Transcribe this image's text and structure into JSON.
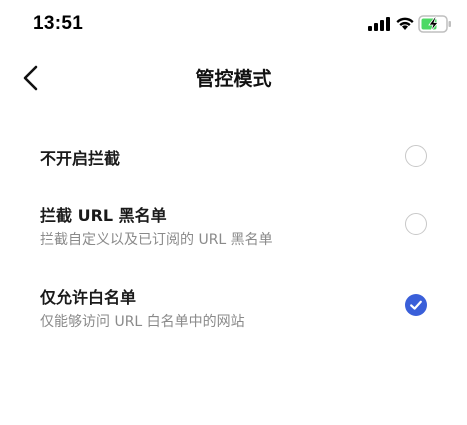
{
  "status_bar": {
    "time": "13:51"
  },
  "nav": {
    "title": "管控模式"
  },
  "options": [
    {
      "title": "不开启拦截",
      "subtitle": "",
      "selected": false
    },
    {
      "title": "拦截 URL 黑名单",
      "subtitle": "拦截自定义以及已订阅的 URL 黑名单",
      "selected": false
    },
    {
      "title": "仅允许白名单",
      "subtitle": "仅能够访问 URL 白名单中的网站",
      "selected": true
    }
  ],
  "colors": {
    "accent": "#3a5fd9",
    "battery": "#4cd964"
  }
}
